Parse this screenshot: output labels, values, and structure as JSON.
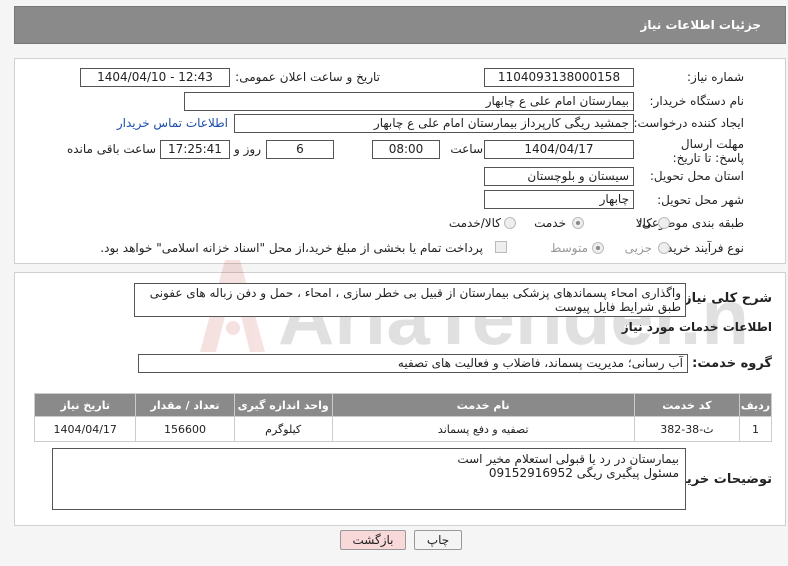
{
  "header": {
    "title": "جزئیات اطلاعات نیاز"
  },
  "form": {
    "need_number_label": "شماره نیاز:",
    "need_number": "1104093138000158",
    "announce_label": "تاریخ و ساعت اعلان عمومی:",
    "announce_value": "1404/04/10 - 12:43",
    "buyer_org_label": "نام دستگاه خریدار:",
    "buyer_org": "بیمارستان امام علی  ع  چابهار",
    "creator_label": "ایجاد کننده درخواست:",
    "creator": "جمشید ریگی کارپرداز بیمارستان امام علی  ع  چابهار",
    "contact_link": "اطلاعات تماس خریدار",
    "deadline_label": "مهلت ارسال پاسخ: تا تاریخ:",
    "deadline_date": "1404/04/17",
    "time_label": "ساعت",
    "deadline_time": "08:00",
    "days_value": "6",
    "days_label": "روز و",
    "remaining_time": "17:25:41",
    "remaining_label": "ساعت باقی مانده",
    "province_label": "استان محل تحویل:",
    "province": "سیستان و بلوچستان",
    "city_label": "شهر محل تحویل:",
    "city": "چابهار",
    "category_label": "طبقه بندی موضوعی:",
    "category_options": [
      "کالا",
      "خدمت",
      "کالا/خدمت"
    ],
    "category_selected": "خدمت",
    "process_label": "نوع فرآیند خرید :",
    "process_options": [
      "جزیی",
      "متوسط"
    ],
    "process_selected": "متوسط",
    "payment_note": "پرداخت تمام یا بخشی از مبلغ خرید،از محل \"اسناد خزانه اسلامی\" خواهد بود."
  },
  "details": {
    "description_label": "شرح کلی نیاز:",
    "description": "واگذاری امحاء پسماندهای پزشکی بیمارستان از قبیل بی خطر سازی ، امحاء ، حمل و دفن زباله های عفونی طبق شرایط فایل پیوست",
    "services_title": "اطلاعات خدمات مورد نیاز",
    "service_group_label": "گروه خدمت:",
    "service_group": "آب رسانی؛ مدیریت پسماند، فاضلاب و فعالیت های تصفیه",
    "table_headers": [
      "ردیف",
      "کد خدمت",
      "نام خدمت",
      "واحد اندازه گیری",
      "تعداد / مقدار",
      "تاریخ نیاز"
    ],
    "rows": [
      {
        "index": "1",
        "code": "ث-38-382",
        "name": "تصفیه و دفع پسماند",
        "unit": "کیلوگرم",
        "qty": "156600",
        "date": "1404/04/17"
      }
    ],
    "buyer_notes_label": "توضیحات خریدار:",
    "buyer_notes_line1": "بیمارستان در رد یا قبولی استعلام مخیر است",
    "buyer_notes_line2": "مسئول پیگیری ریگی 09152916952"
  },
  "buttons": {
    "print": "چاپ",
    "back": "بازگشت"
  },
  "watermark": {
    "text": "AriaTender.net"
  }
}
